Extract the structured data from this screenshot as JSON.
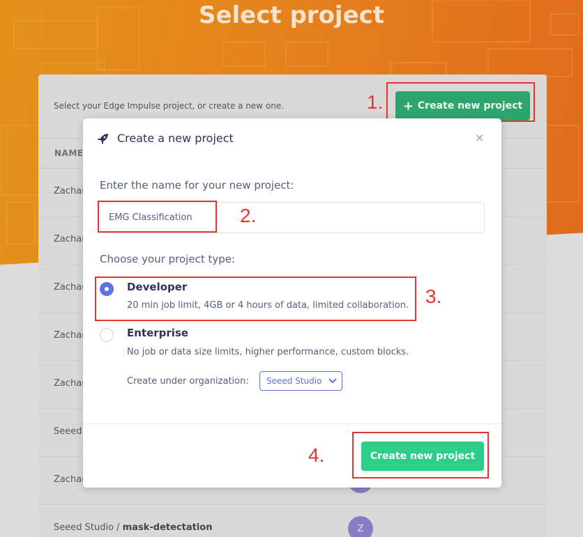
{
  "page": {
    "title": "Select project"
  },
  "card": {
    "description": "Select your Edge Impulse project, or create a new one.",
    "create_button_label": "Create new project",
    "column_header": "NAME",
    "rows": [
      {
        "owner": "Zachar",
        "project": ""
      },
      {
        "owner": "Zachar",
        "project": ""
      },
      {
        "owner": "Zachar",
        "project": ""
      },
      {
        "owner": "Zachar",
        "project": ""
      },
      {
        "owner": "Zachar",
        "project": ""
      },
      {
        "owner": "Seeed S",
        "project": ""
      },
      {
        "owner": "Zachar",
        "project": ""
      },
      {
        "owner": "Seeed Studio / ",
        "project": "mask-detectation",
        "avatar": "Z"
      }
    ]
  },
  "modal": {
    "title": "Create a new project",
    "close_icon": "×",
    "name_label": "Enter the name for your new project:",
    "name_value": "EMG Classification",
    "type_label": "Choose your project type:",
    "options": [
      {
        "title": "Developer",
        "description": "20 min job limit, 4GB or 4 hours of data, limited collaboration.",
        "selected": true
      },
      {
        "title": "Enterprise",
        "description": "No job or data size limits, higher performance, custom blocks.",
        "selected": false
      }
    ],
    "org_label": "Create under organization:",
    "org_value": "Seeed Studio",
    "create_button_label": "Create new project"
  },
  "annotations": [
    "1.",
    "2.",
    "3.",
    "4."
  ],
  "colors": {
    "accent": "#5e72e4",
    "success": "#2dce89",
    "annotation": "#e3342f",
    "header_orange": "#e5821d"
  }
}
